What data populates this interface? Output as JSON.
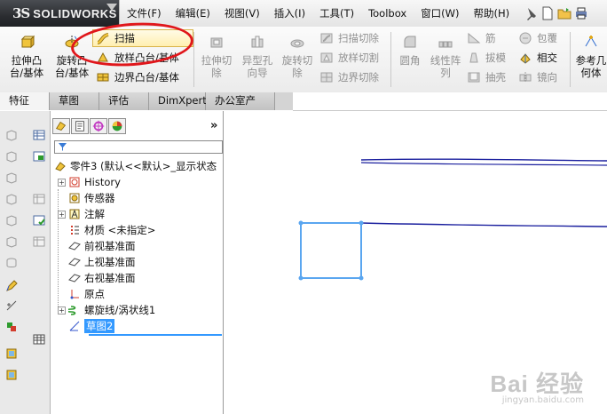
{
  "app": {
    "logo_ds": "3S",
    "logo_text": "SOLIDWORKS"
  },
  "menu": [
    "文件(F)",
    "编辑(E)",
    "视图(V)",
    "插入(I)",
    "工具(T)",
    "Toolbox",
    "窗口(W)",
    "帮助(H)"
  ],
  "toolbar": {
    "extrude_boss": "拉伸凸\n台/基体",
    "revolve_boss": "旋转凸\n台/基体",
    "sweep": "扫描",
    "loft": "放样凸台/基体",
    "boundary": "边界凸台/基体",
    "extrude_cut": "拉伸切\n除",
    "hole_wizard": "异型孔\n向导",
    "revolve_cut": "旋转切\n除",
    "swept_cut": "扫描切除",
    "lofted_cut": "放样切割",
    "boundary_cut": "边界切除",
    "fillet": "圆角",
    "linear_pattern": "线性阵\n列",
    "rib": "筋",
    "draft": "拔模",
    "shell": "抽壳",
    "wrap": "包覆",
    "intersect": "相交",
    "mirror": "镜向",
    "ref_geometry": "参考几\n何体"
  },
  "tabs": [
    "特征",
    "草图",
    "评估",
    "DimXpert",
    "办公室产品"
  ],
  "tree": {
    "root": "零件3 (默认<<默认>_显示状态",
    "items": [
      {
        "label": "History",
        "expandable": true,
        "icon": "history-icon"
      },
      {
        "label": "传感器",
        "expandable": false,
        "icon": "sensor-icon"
      },
      {
        "label": "注解",
        "expandable": true,
        "icon": "annotation-icon"
      },
      {
        "label": "材质 <未指定>",
        "expandable": false,
        "icon": "material-icon"
      },
      {
        "label": "前视基准面",
        "expandable": false,
        "icon": "plane-icon"
      },
      {
        "label": "上视基准面",
        "expandable": false,
        "icon": "plane-icon"
      },
      {
        "label": "右视基准面",
        "expandable": false,
        "icon": "plane-icon"
      },
      {
        "label": "原点",
        "expandable": false,
        "icon": "origin-icon"
      },
      {
        "label": "螺旋线/涡状线1",
        "expandable": true,
        "icon": "helix-icon"
      },
      {
        "label": "草图2",
        "expandable": false,
        "icon": "sketch-icon",
        "selected": true
      }
    ]
  },
  "panel": {
    "chevron": "»"
  },
  "watermark": {
    "brand": "Bai  经验",
    "url": "jingyan.baidu.com"
  },
  "colors": {
    "selection": "#3399ff",
    "helix": "#1a1f9e",
    "sketch": "#5aa6f0",
    "annotation": "#e0161b"
  }
}
